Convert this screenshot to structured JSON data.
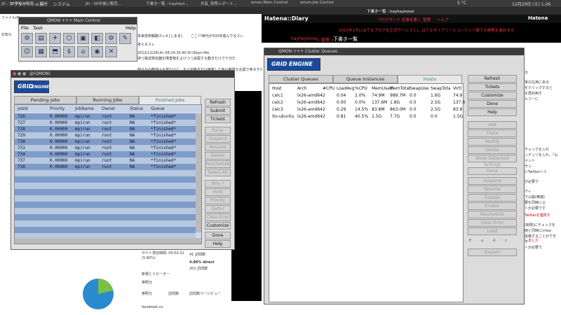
{
  "panel": {
    "apps": "アプリケーション",
    "places": "場所",
    "system": "システム",
    "temp": "5 °C",
    "date": "12月29日 (土)  1:26"
  },
  "browser_tabs": [
    "JD - 50年後に販売...",
    "JD - 50年後に販売...",
    "下書き一覧 - hayheyt...",
    "共有_良照レポート...",
    "qmon:Main Control",
    "qmon:Job Control"
  ],
  "bg_page": {
    "line1": "ファイル(F)",
    "line2": "お知ら",
    "thread_title": "未来技術報酬スレ4 [しまま]",
    "thread_title2": "ここ!!!時代が500年進んでるスレ",
    "post_date": "2012/12/26(木) 08:24:30.40 ID:Obqi+4tk",
    "post_text1": "持つ電波発信器を障害物をよけつつ追尾する動きだけで十分だ",
    "post_text2": "旋るかの動作は大変だけど、主人が稼ぎだけ用意して後は簡単な言葉で命令すれば反応するようにすれば",
    "post_tail": "考えるスレ",
    "side_labels": [
      "総計",
      "ラン"
    ],
    "stats": {
      "visit_count": "41 訪問数",
      "pct": "4.86% direct",
      "pages": "201 訪問数",
      "new_return": "新規とリピーター",
      "referrer": "参照元",
      "ref_cols": [
        "参照元",
        "訪問数",
        "訪問数ページビュー"
      ],
      "ref_row": "facebook.co",
      "site_time": "サイト滞在時間: 00:02:21",
      "site_pct": "(5.80%)"
    }
  },
  "hatena": {
    "tab": "下書き一覧 - hayheytoner",
    "brand": "Hatena::Diary",
    "links": [
      "ブログモード",
      "記事を書く",
      "管理",
      "ヘルプ"
    ],
    "announce": "2013年1月にはてなブログを正式サービスとし はてなダイアリーとコンテンツ面での連携を進めます",
    "breadcrumb_user": "hayheytoner",
    "breadcrumb_sep": "> 管理 >",
    "breadcrumb_page": "下書き一覧",
    "hatena_logo": "Hatena",
    "right_texts": [
      "る",
      "事の左用にある",
      "をクリックすると",
      "を再利用す",
      "ルフーに",
      "チェックを入れ",
      "ンテンツを入れ。「公",
      "メント",
      "サン",
      "にTwitterへう",
      "が必要で",
      "ディ",
      "で公開(無期)",
      "要を同時に公",
      "トが必要です",
      "Twitterを連携す",
      "(制限)にチェックを",
      "時と同時に(mia)",
      "投稿することができ",
      "で",
      "トが必要で",
      "しました"
    ]
  },
  "main_control": {
    "title": "QMON +++ Main Control",
    "menu": [
      "File",
      "Task",
      "Help"
    ],
    "icons": [
      "job-control-icon",
      "queue-control-icon",
      "submit-job-icon",
      "complex-config-icon",
      "host-config-icon",
      "cluster-config-icon",
      "scheduler-config-icon",
      "calendar-config-icon",
      "user-config-icon",
      "pe-config-icon",
      "checkpoint-config-icon",
      "ticket-overview-icon",
      "project-config-icon",
      "browser-icon",
      "exit-icon"
    ],
    "glyphs": [
      "⚙",
      "▤",
      "✈",
      "⬡",
      "▣",
      "◧",
      "⚙",
      "✎",
      "☺",
      "▦",
      "⬒",
      "$",
      "⌂",
      "◉",
      "✕"
    ]
  },
  "job_control": {
    "title": "@(QMON)",
    "logo_main": "GRID",
    "logo_sub": "ENGINE",
    "tabs": [
      "Pending Jobs",
      "Running Jobs",
      "Finished Jobs"
    ],
    "active_tab": 2,
    "columns": [
      "JobId",
      "Priority",
      "JobName",
      "Owner",
      "Status",
      "Queue"
    ],
    "rows": [
      [
        "726",
        "0.00000",
        "mpirun",
        "root",
        "NA",
        "*finished*"
      ],
      [
        "727",
        "0.00000",
        "mpirun",
        "root",
        "NA",
        "*finished*"
      ],
      [
        "728",
        "0.00000",
        "mpirun",
        "root",
        "NA",
        "*finished*"
      ],
      [
        "729",
        "0.00000",
        "mpirun",
        "root",
        "NA",
        "*finished*"
      ],
      [
        "730",
        "0.00000",
        "mpirun",
        "root",
        "NA",
        "*finished*"
      ],
      [
        "731",
        "0.00000",
        "mpirun",
        "root",
        "NA",
        "*finished*"
      ],
      [
        "734",
        "0.00000",
        "mpirun",
        "root",
        "NA",
        "*finished*"
      ],
      [
        "737",
        "0.00000",
        "mpirun",
        "root",
        "NA",
        "*finished*"
      ],
      [
        "738",
        "0.00000",
        "mpirun",
        "root",
        "NA",
        "*finished*"
      ]
    ],
    "buttons": [
      {
        "label": "Refresh",
        "enabled": true
      },
      {
        "label": "Submit",
        "enabled": true
      },
      {
        "label": "Tickets",
        "enabled": true
      },
      {
        "label": "Force",
        "enabled": false
      },
      {
        "label": "Suspend",
        "enabled": false
      },
      {
        "label": "Resume",
        "enabled": false
      },
      {
        "label": "Delete",
        "enabled": false
      },
      {
        "label": "Reschedule",
        "enabled": false
      },
      {
        "label": "Select All",
        "enabled": false
      },
      {
        "label": "Why ?",
        "enabled": false
      },
      {
        "label": "Hold",
        "enabled": false
      },
      {
        "label": "Priority",
        "enabled": false
      },
      {
        "label": "Qalter",
        "enabled": false
      },
      {
        "label": "Clear Error",
        "enabled": false
      },
      {
        "label": "Customize",
        "enabled": true
      },
      {
        "label": "Done",
        "enabled": true
      },
      {
        "label": "Help",
        "enabled": true
      }
    ]
  },
  "cluster_queues": {
    "title": "QMON +++ Cluster Queues",
    "logo_main": "GRID",
    "logo_sub": "ENGINE",
    "tabs": [
      "Cluster Queues",
      "Queue Instances",
      "Hosts"
    ],
    "active_tab": 2,
    "columns": [
      "Host",
      "Arch",
      "#CPU",
      "LoadAvg",
      "%CPU",
      "MemUsed",
      "MemTotal",
      "SwapUse",
      "SwapTota",
      "Virtl"
    ],
    "rows": [
      [
        "calc1",
        "lx26-amd64",
        "2",
        "0.04",
        "2.0%",
        "74.9M",
        "989.7M",
        "0.0",
        "1.6G",
        "74.9"
      ],
      [
        "calc2",
        "lx26-amd64",
        "2",
        "0.00",
        "0.0%",
        "137.6M",
        "1.8G",
        "0.0",
        "2.5G",
        "137.6"
      ],
      [
        "calc3",
        "lx26-amd64",
        "2",
        "0.29",
        "14.5%",
        "83.8M",
        "863.0M",
        "0.0",
        "2.5G",
        "83.8"
      ],
      [
        "ito-ubuntu",
        "lx26-amd64",
        "2",
        "0.81",
        "40.5%",
        "1.5G",
        "7.7G",
        "0.0",
        "0.0",
        "1.5G"
      ]
    ],
    "buttons": [
      {
        "label": "Refresh",
        "enabled": true
      },
      {
        "label": "Tickets",
        "enabled": true
      },
      {
        "label": "Customize",
        "enabled": true
      },
      {
        "label": "Done",
        "enabled": true
      },
      {
        "label": "Help",
        "enabled": true
      },
      {
        "label": "Add",
        "enabled": false
      },
      {
        "label": "Clone",
        "enabled": false
      },
      {
        "label": "Modify",
        "enabled": false
      },
      {
        "label": "Delete",
        "enabled": false
      },
      {
        "label": "Show Detached Settings",
        "enabled": false
      },
      {
        "label": "Force",
        "enabled": false
      },
      {
        "label": "Suspend",
        "enabled": false
      },
      {
        "label": "Resume",
        "enabled": false
      },
      {
        "label": "Disable",
        "enabled": false
      },
      {
        "label": "Enable",
        "enabled": false
      },
      {
        "label": "Reschedule",
        "enabled": false
      },
      {
        "label": "Clear Error",
        "enabled": false
      },
      {
        "label": "Load",
        "enabled": false
      },
      {
        "label": "Explain",
        "enabled": false
      }
    ],
    "explain_letters": [
      "E",
      "a",
      "A",
      "c"
    ]
  },
  "colors": {
    "row_blue": "#7f9cc8",
    "row_light": "#b7c8e2",
    "grid_logo": "#1a4a9a",
    "hosts_tab": "#3a8a8a"
  }
}
